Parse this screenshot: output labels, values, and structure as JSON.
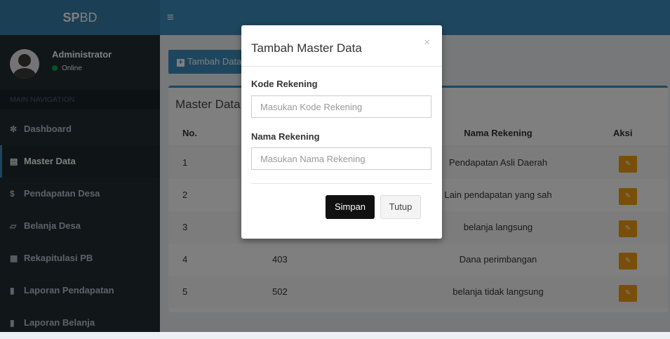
{
  "logo": {
    "bold": "SP",
    "rest": "BD"
  },
  "user": {
    "name": "Administrator",
    "status": "Online"
  },
  "nav": {
    "header": "MAIN NAVIGATION",
    "items": [
      {
        "label": "Dashboard",
        "icon": "home-icon"
      },
      {
        "label": "Master Data",
        "icon": "bank-icon"
      },
      {
        "label": "Pendapatan Desa",
        "icon": "dollar-icon"
      },
      {
        "label": "Belanja Desa",
        "icon": "cart-icon"
      },
      {
        "label": "Rekapitulasi PB",
        "icon": "grid-icon"
      },
      {
        "label": "Laporan Pendapatan",
        "icon": "file-icon"
      },
      {
        "label": "Laporan Belanja",
        "icon": "file-icon"
      }
    ],
    "active": "Master Data"
  },
  "toolbar": {
    "add_label": "Tambah Data"
  },
  "box": {
    "title": "Master Data"
  },
  "table": {
    "headers": {
      "no": "No.",
      "kode": "",
      "nama": "Nama Rekening",
      "aksi": "Aksi"
    },
    "rows": [
      {
        "no": "1",
        "kode": "",
        "nama": "Pendapatan Asli Daerah"
      },
      {
        "no": "2",
        "kode": "",
        "nama": "Lain pendapatan yang sah"
      },
      {
        "no": "3",
        "kode": "",
        "nama": "belanja langsung"
      },
      {
        "no": "4",
        "kode": "403",
        "nama": "Dana perimbangan"
      },
      {
        "no": "5",
        "kode": "502",
        "nama": "belanja tidak langsung"
      }
    ]
  },
  "modal": {
    "title": "Tambah Master Data",
    "close": "×",
    "kode_label": "Kode Rekening",
    "kode_placeholder": "Masukan Kode Rekening",
    "nama_label": "Nama Rekening",
    "nama_placeholder": "Masukan Nama Rekening",
    "save_label": "Simpan",
    "close_label": "Tutup"
  },
  "colors": {
    "accent": "#3c8dbc",
    "sidebar": "#222d32",
    "edit": "#f39c12",
    "online": "#00a65a"
  }
}
